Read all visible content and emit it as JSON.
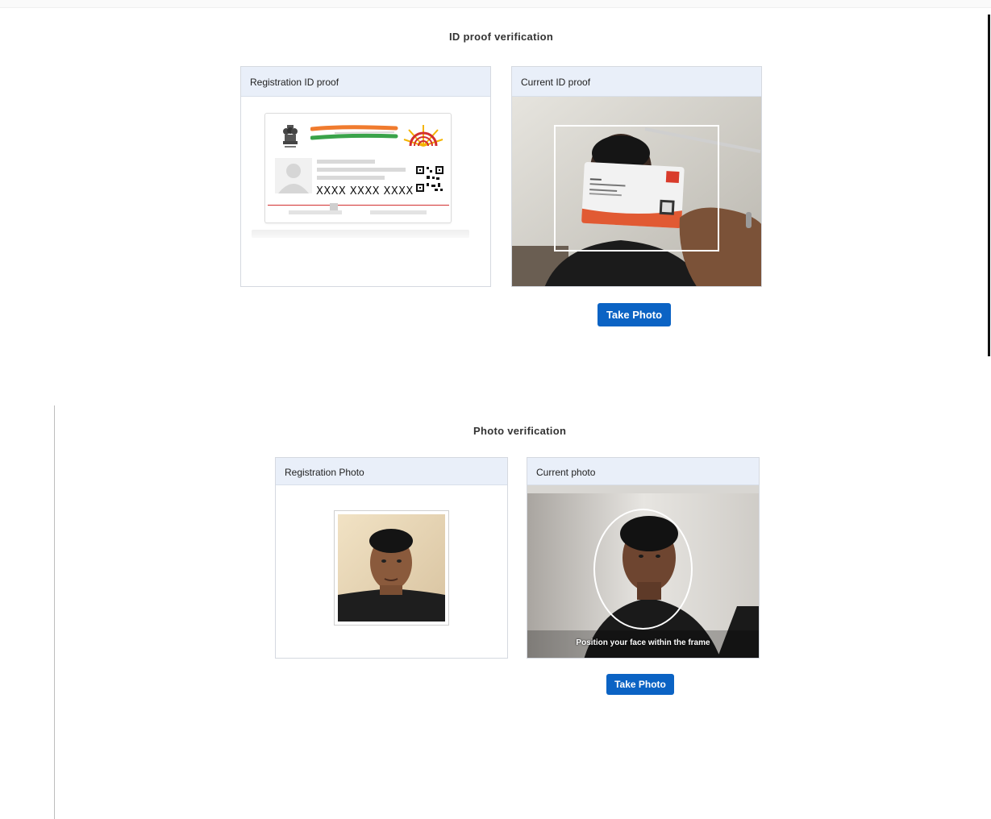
{
  "id_section": {
    "title": "ID proof verification",
    "registration_panel": {
      "header": "Registration ID proof",
      "id_number": "XXXX XXXX XXXX"
    },
    "current_panel": {
      "header": "Current ID proof"
    },
    "take_photo_label": "Take Photo"
  },
  "photo_section": {
    "title": "Photo verification",
    "registration_panel": {
      "header": "Registration Photo"
    },
    "current_panel": {
      "header": "Current photo",
      "overlay_text": "Position your face within the frame"
    },
    "take_photo_label": "Take Photo"
  },
  "colors": {
    "primary_button": "#0b63c4",
    "panel_header": "#e9eff9",
    "panel_border": "#d5d9e0"
  },
  "icons": [
    "emblem-icon",
    "aadhaar-logo-icon",
    "qr-code-icon",
    "avatar-icon"
  ]
}
